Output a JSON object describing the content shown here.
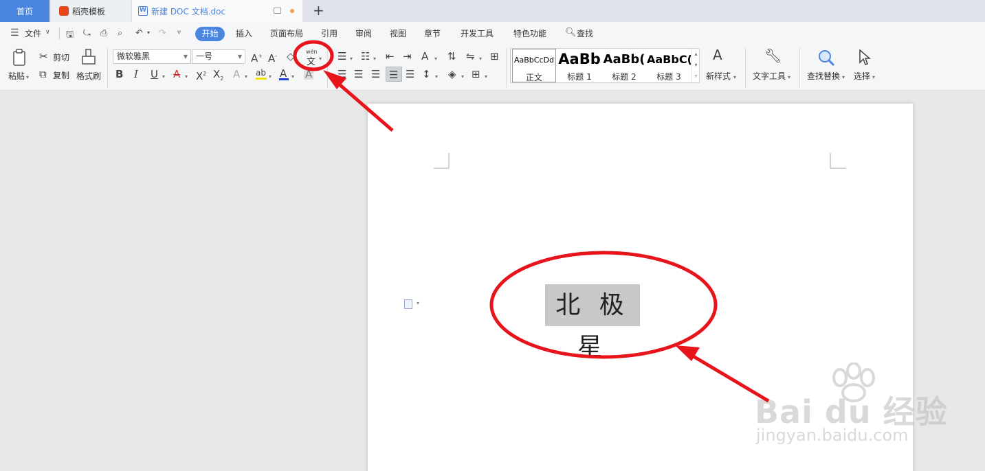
{
  "tabs": [
    {
      "label": "首页",
      "icon": "home"
    },
    {
      "label": "稻壳模板",
      "icon": "docer-icon"
    },
    {
      "label": "新建 DOC 文档.doc",
      "icon": "word-doc-icon"
    }
  ],
  "new_tab_symbol": "+",
  "menu": {
    "file_label": "文件",
    "items": [
      "开始",
      "插入",
      "页面布局",
      "引用",
      "审阅",
      "视图",
      "章节",
      "开发工具",
      "特色功能"
    ],
    "active": "开始",
    "search_label": "查找"
  },
  "ribbon": {
    "paste_label": "粘贴",
    "cut_label": "剪切",
    "copy_label": "复制",
    "format_painter_label": "格式刷",
    "font_name": "微软雅黑",
    "font_size": "一号",
    "bold": "B",
    "italic": "I",
    "underline": "U",
    "phonetic_top": "wén",
    "phonetic_char": "文",
    "styles": [
      {
        "sample": "AaBbCcDd",
        "name": "正文"
      },
      {
        "sample": "AaBb",
        "name": "标题 1"
      },
      {
        "sample": "AaBb(",
        "name": "标题 2"
      },
      {
        "sample": "AaBbC(",
        "name": "标题 3"
      }
    ],
    "new_style_label": "新样式",
    "text_tools_label": "文字工具",
    "find_replace_label": "查找替换",
    "select_label": "选择"
  },
  "document": {
    "selected_text": "北 极 星"
  },
  "watermark": {
    "brand": "Bai du 经验",
    "url": "jingyan.baidu.com"
  },
  "colors": {
    "accent": "#4a86e0",
    "annotation": "#e8141b",
    "highlight_yellow": "#f2e600",
    "font_color_blue": "#1b3fcf"
  }
}
